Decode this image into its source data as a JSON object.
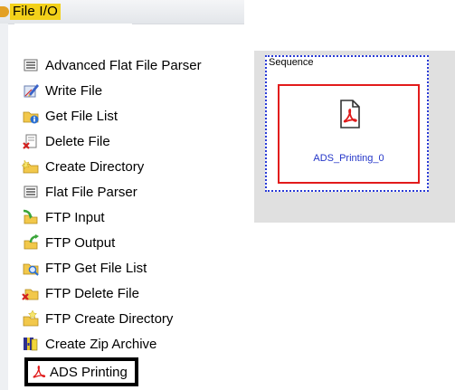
{
  "palette": {
    "category_title": "File I/O",
    "items": [
      {
        "label": "Advanced Flat File Parser",
        "icon": "flat-file-parser-icon"
      },
      {
        "label": "Write File",
        "icon": "write-file-icon"
      },
      {
        "label": "Get File List",
        "icon": "get-file-list-icon"
      },
      {
        "label": "Delete File",
        "icon": "delete-file-icon"
      },
      {
        "label": "Create Directory",
        "icon": "create-directory-icon"
      },
      {
        "label": "Flat File Parser",
        "icon": "flat-file-parser-icon"
      },
      {
        "label": "FTP Input",
        "icon": "ftp-input-icon"
      },
      {
        "label": "FTP Output",
        "icon": "ftp-output-icon"
      },
      {
        "label": "FTP Get File List",
        "icon": "ftp-get-file-list-icon"
      },
      {
        "label": "FTP Delete File",
        "icon": "ftp-delete-file-icon"
      },
      {
        "label": "FTP Create Directory",
        "icon": "ftp-create-directory-icon"
      },
      {
        "label": "Create Zip Archive",
        "icon": "zip-archive-icon"
      },
      {
        "label": "ADS Printing",
        "icon": "pdf-icon",
        "selected": true
      }
    ]
  },
  "canvas": {
    "sequence_label": "Sequence",
    "node_label": "ADS_Printing_0",
    "node_icon": "pdf-document-icon"
  },
  "colors": {
    "category_highlight": "#f3d11a",
    "selection_border": "#000000",
    "node_border": "#e21b1b",
    "sequence_border": "#2a3bd6",
    "node_text": "#2335c8",
    "canvas_bg": "#e0e0e0"
  }
}
